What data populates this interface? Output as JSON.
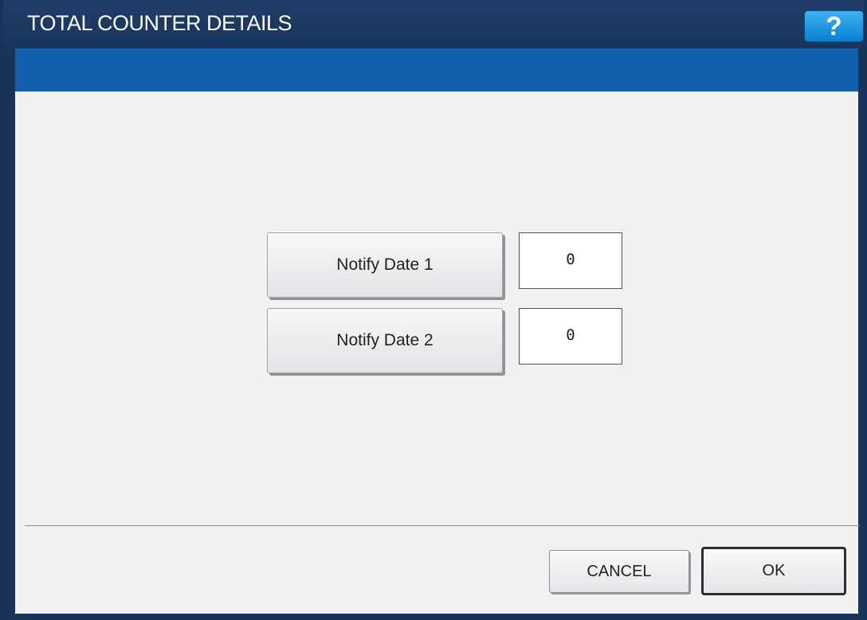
{
  "window": {
    "title": "TOTAL COUNTER DETAILS",
    "help_label": "?"
  },
  "fields": [
    {
      "label": "Notify Date 1",
      "value": "0"
    },
    {
      "label": "Notify Date 2",
      "value": "0"
    }
  ],
  "footer": {
    "cancel_label": "CANCEL",
    "ok_label": "OK"
  },
  "colors": {
    "title_bar": "#1a355c",
    "band": "#1560ac",
    "help_button": "#1a8fe0",
    "content_bg": "#f0f1f3"
  }
}
